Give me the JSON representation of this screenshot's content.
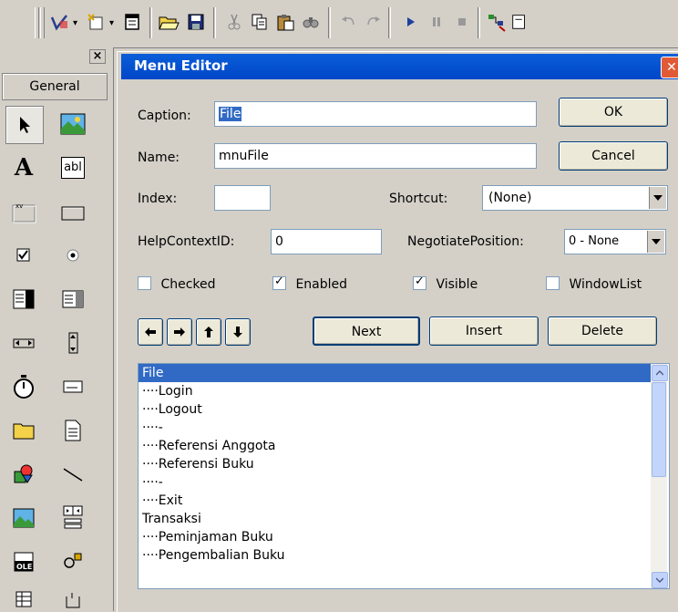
{
  "toolbox": {
    "close_glyph": "×",
    "tab_label": "General"
  },
  "dialog": {
    "title": "Menu Editor",
    "close_glyph": "✕",
    "caption_label": "Caption:",
    "caption_value": "File",
    "name_label": "Name:",
    "name_value": "mnuFile",
    "index_label": "Index:",
    "index_value": "",
    "shortcut_label": "Shortcut:",
    "shortcut_value": "(None)",
    "helpcontext_label": "HelpContextID:",
    "helpcontext_value": "0",
    "negotiate_label": "NegotiatePosition:",
    "negotiate_value": "0 - None",
    "ok_label": "OK",
    "cancel_label": "Cancel",
    "checked_label": "Checked",
    "checked_state": false,
    "enabled_label": "Enabled",
    "enabled_state": true,
    "visible_label": "Visible",
    "visible_state": true,
    "windowlist_label": "WindowList",
    "windowlist_state": false,
    "next_label": "Next",
    "insert_label": "Insert",
    "delete_label": "Delete",
    "menu_items": [
      "File",
      "····Login",
      "····Logout",
      "····-",
      "····Referensi Anggota",
      "····Referensi Buku",
      "····-",
      "····Exit",
      "Transaksi",
      "····Peminjaman Buku",
      "····Pengembalian Buku"
    ],
    "selected_item": "File"
  }
}
